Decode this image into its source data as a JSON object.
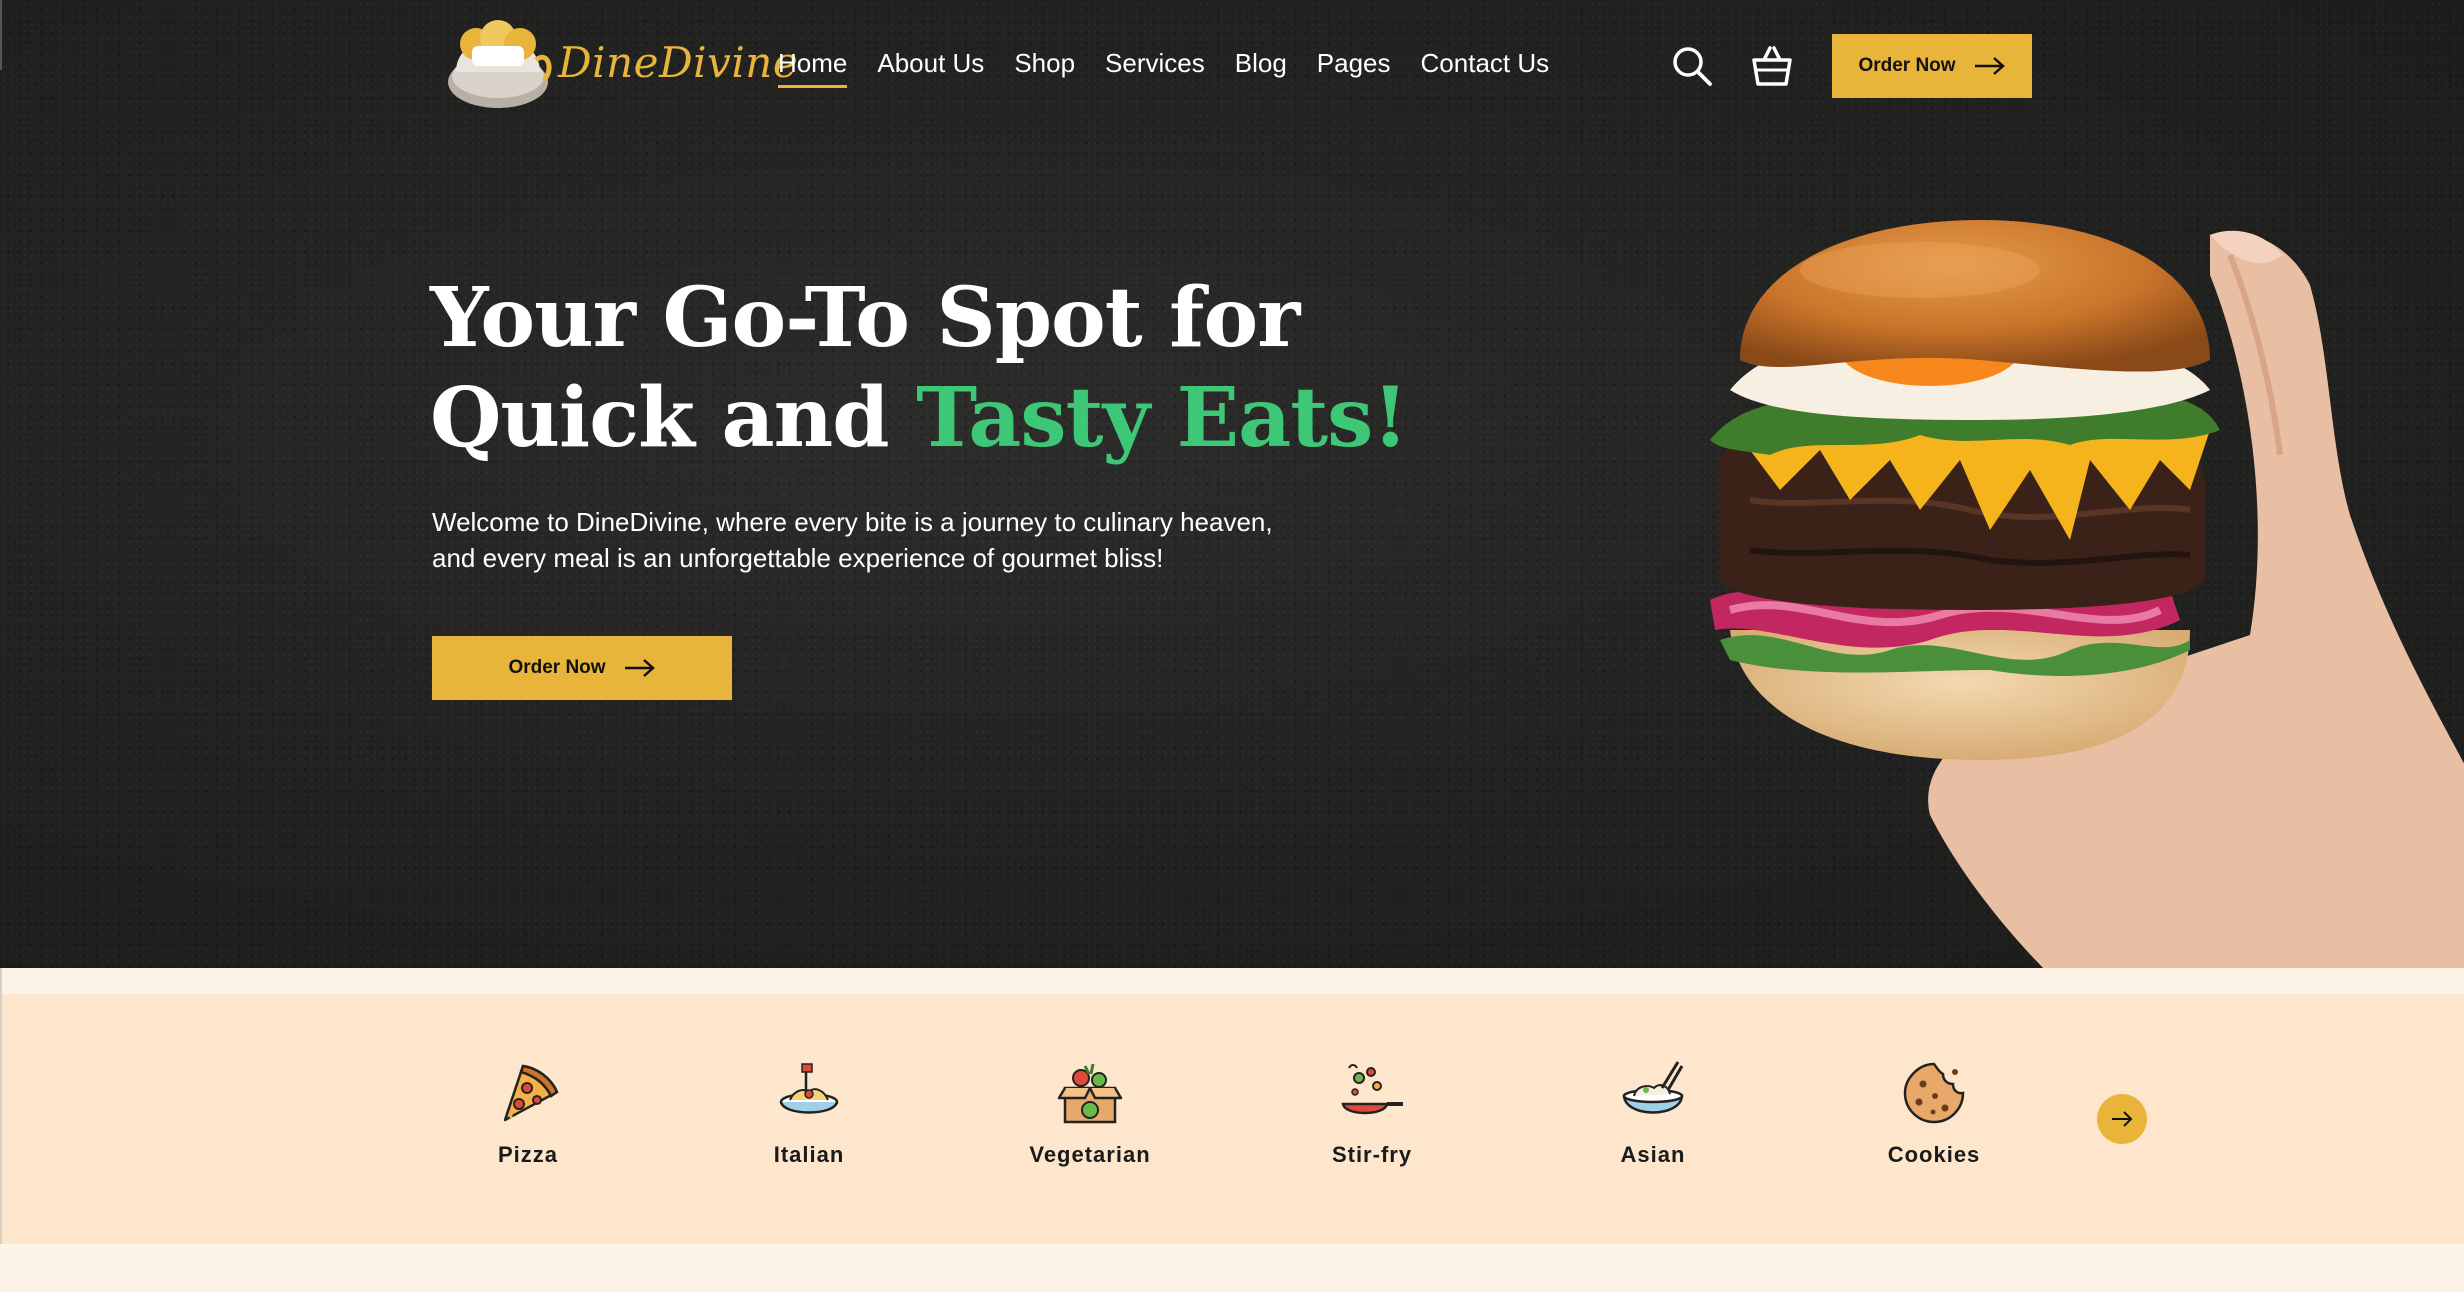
{
  "brand": {
    "name": "DineDivine",
    "accent": "#e8b43a",
    "green": "#3ec776",
    "dark": "#232322"
  },
  "nav": {
    "items": [
      {
        "label": "Home",
        "active": true
      },
      {
        "label": "About Us"
      },
      {
        "label": "Shop"
      },
      {
        "label": "Services"
      },
      {
        "label": "Blog"
      },
      {
        "label": "Pages"
      },
      {
        "label": "Contact Us"
      }
    ],
    "search_icon": "search-icon",
    "cart_icon": "basket-icon",
    "order_label": "Order Now"
  },
  "hero": {
    "title_line1": "Your Go-To Spot for",
    "title_line2_plain": "Quick and ",
    "title_line2_accent": "Tasty Eats!",
    "description_line1": "Welcome to DineDivine, where every bite is a journey to culinary heaven,",
    "description_line2": "and every meal is an unforgettable experience of gourmet bliss!",
    "cta_label": "Order Now"
  },
  "categories": {
    "items": [
      {
        "label": "Pizza",
        "icon": "pizza-icon"
      },
      {
        "label": "Italian",
        "icon": "pasta-icon"
      },
      {
        "label": "Vegetarian",
        "icon": "vegetable-box-icon"
      },
      {
        "label": "Stir-fry",
        "icon": "stir-fry-pan-icon"
      },
      {
        "label": "Asian",
        "icon": "noodle-bowl-icon"
      },
      {
        "label": "Cookies",
        "icon": "cookie-icon"
      }
    ],
    "next_icon": "arrow-right-icon"
  }
}
